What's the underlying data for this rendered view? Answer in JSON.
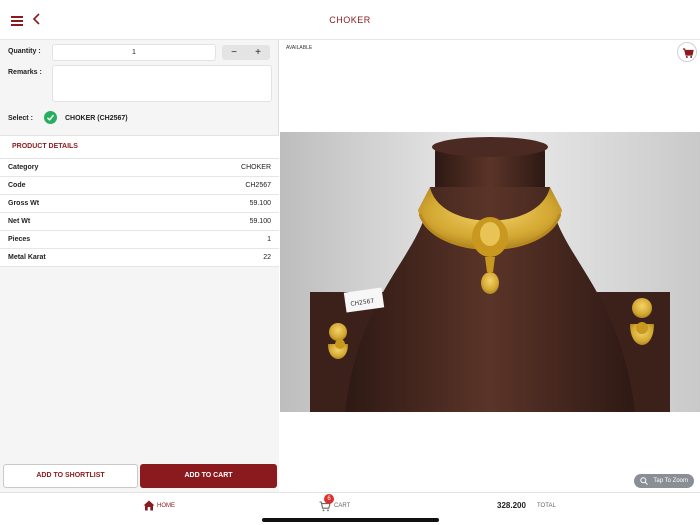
{
  "header": {
    "title": "CHOKER"
  },
  "form": {
    "quantity_label": "Quantity :",
    "quantity_value": "1",
    "stepper_minus": "−",
    "stepper_plus": "+",
    "remarks_label": "Remarks :",
    "select_label": "Select :",
    "select_value": "CHOKER (CH2567)"
  },
  "details": {
    "title": "PRODUCT DETAILS",
    "rows": [
      {
        "key": "Category",
        "value": "CHOKER"
      },
      {
        "key": "Code",
        "value": "CH2567"
      },
      {
        "key": "Gross Wt",
        "value": "59.100"
      },
      {
        "key": "Net Wt",
        "value": "59.100"
      },
      {
        "key": "Pieces",
        "value": "1"
      },
      {
        "key": "Metal Karat",
        "value": "22"
      }
    ]
  },
  "actions": {
    "shortlist": "ADD TO SHORTLIST",
    "cart": "ADD TO CART"
  },
  "image_panel": {
    "status": "AVAILABLE",
    "tag_text": "CH2567",
    "zoom_label": "Tap To Zoom",
    "colors": {
      "background": "#e2e2e2",
      "velvet": "#4a2a22",
      "gold": "#d4a832"
    }
  },
  "footer": {
    "home_label": "HOME",
    "cart_label": "CART",
    "cart_count": "6",
    "total_value": "328.200",
    "total_label": "TOTAL"
  },
  "colors": {
    "brand": "#8b1a1f",
    "check": "#27ae60",
    "badge": "#d9302c"
  }
}
